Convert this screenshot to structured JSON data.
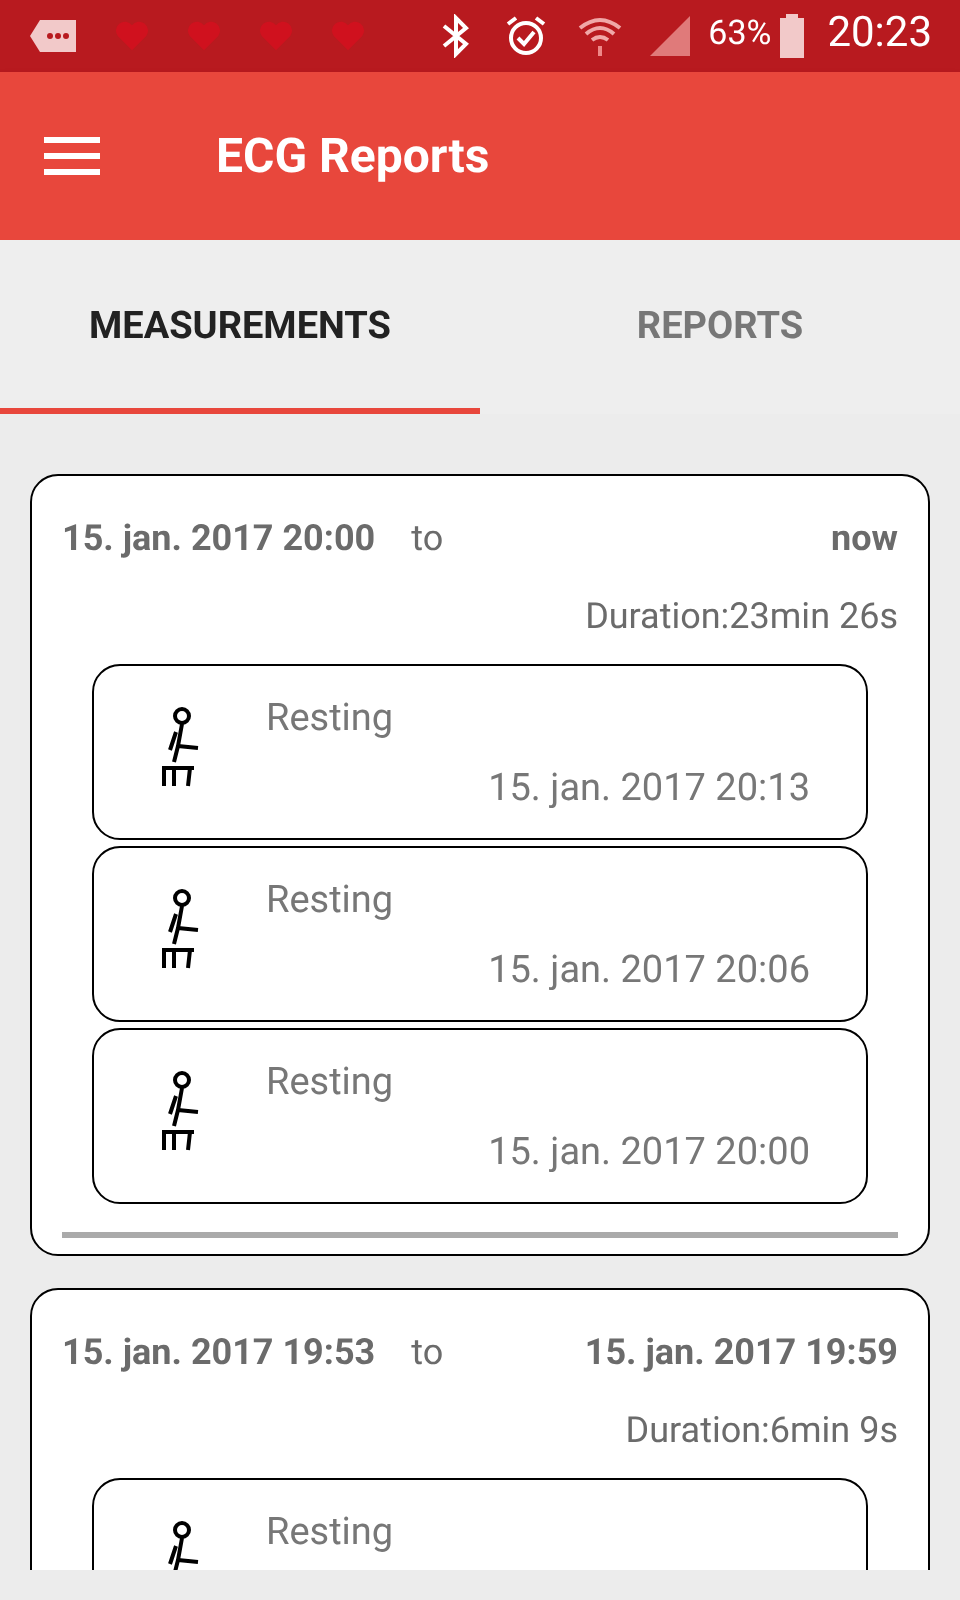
{
  "status_bar": {
    "battery": "63%",
    "time": "20:23"
  },
  "toolbar": {
    "title": "ECG Reports"
  },
  "tabs": [
    {
      "label": "MEASUREMENTS",
      "selected": true
    },
    {
      "label": "REPORTS",
      "selected": false
    }
  ],
  "sessions": [
    {
      "start": "15. jan. 2017 20:00",
      "separator": "to",
      "end": "now",
      "duration": "Duration:23min 26s",
      "items": [
        {
          "activity": "Resting",
          "time": "15. jan. 2017 20:13"
        },
        {
          "activity": "Resting",
          "time": "15. jan. 2017 20:06"
        },
        {
          "activity": "Resting",
          "time": "15. jan. 2017 20:00"
        }
      ]
    },
    {
      "start": "15. jan. 2017 19:53",
      "separator": "to",
      "end": "15. jan. 2017 19:59",
      "duration": "Duration:6min 9s",
      "items": [
        {
          "activity": "Resting"
        }
      ]
    }
  ]
}
